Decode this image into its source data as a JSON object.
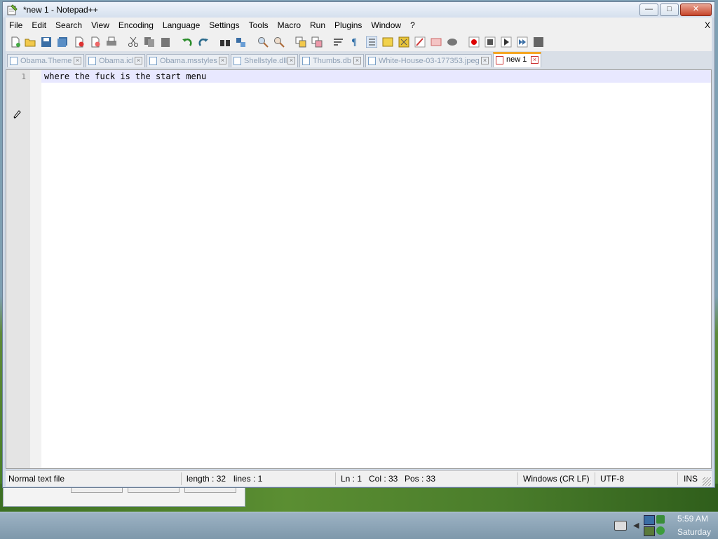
{
  "window": {
    "title": "*new 1 - Notepad++"
  },
  "menubar": {
    "items": [
      "File",
      "Edit",
      "Search",
      "View",
      "Encoding",
      "Language",
      "Settings",
      "Tools",
      "Macro",
      "Run",
      "Plugins",
      "Window",
      "?"
    ],
    "close_doc": "X"
  },
  "tabs": [
    {
      "label": "Obama.Theme",
      "active": false
    },
    {
      "label": "Obama.icl",
      "active": false
    },
    {
      "label": "Obama.msstyles",
      "active": false
    },
    {
      "label": "Shellstyle.dll",
      "active": false
    },
    {
      "label": "Thumbs.db",
      "active": false
    },
    {
      "label": "White-House-03-177353.jpeg",
      "active": false
    },
    {
      "label": "new 1",
      "active": true
    }
  ],
  "editor": {
    "line_number": "1",
    "line_text": "where the fuck is the start menu"
  },
  "statusbar": {
    "file_type": "Normal text file",
    "length": "length : 32",
    "lines": "lines : 1",
    "ln": "Ln : 1",
    "col": "Col : 33",
    "pos": "Pos : 33",
    "eol": "Windows (CR LF)",
    "encoding": "UTF-8",
    "mode": "INS"
  },
  "taskbar": {
    "time": "5:59 AM",
    "day": "Saturday"
  },
  "colors": {
    "active_tab_accent": "#f5a623",
    "current_line": "#e8e8ff"
  }
}
